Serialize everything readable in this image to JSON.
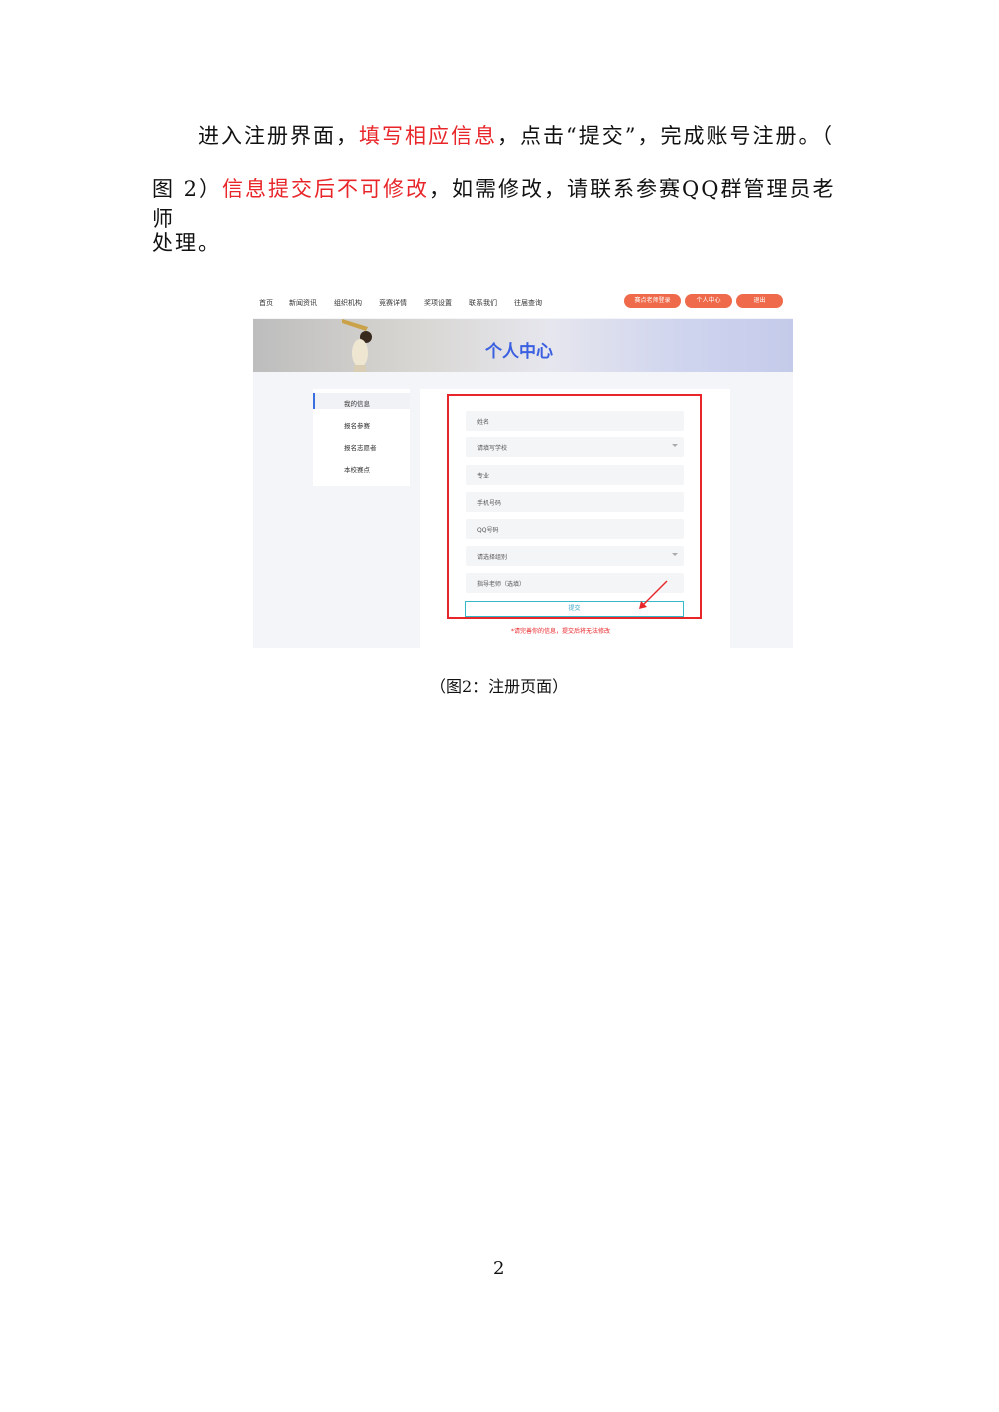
{
  "paragraph": {
    "line1_a": "进入注册界面，",
    "line1_red": "填写相应信息",
    "line1_b": "，点击“提交”，完成账号注册。（",
    "line2_a": "图 2）",
    "line2_red": "信息提交后不可修改",
    "line2_b": "，如需修改，请联系参赛QQ群管理员老师",
    "line3": "处理。"
  },
  "screenshot": {
    "nav": [
      "首页",
      "新闻资讯",
      "组织机构",
      "竞赛详情",
      "奖项设置",
      "联系我们",
      "往届查询"
    ],
    "pills": [
      "赛点老师登录",
      "个人中心",
      "退出"
    ],
    "banner_title": "个人中心",
    "side_menu": [
      "我的信息",
      "报名参赛",
      "报名志愿者",
      "本校赛点"
    ],
    "fields": {
      "name": "姓名",
      "school": "请填写学校",
      "major": "专业",
      "phone": "手机号码",
      "qq": "QQ号码",
      "group": "请选择组别",
      "teacher": "指导老师（选填）"
    },
    "submit": "提交",
    "notice": "*请完善你的信息，提交后将无法修改",
    "accent_color": "#e8262a",
    "pill_color": "#ef6a4a"
  },
  "caption": "（图2：注册页面）",
  "page_number": "2"
}
